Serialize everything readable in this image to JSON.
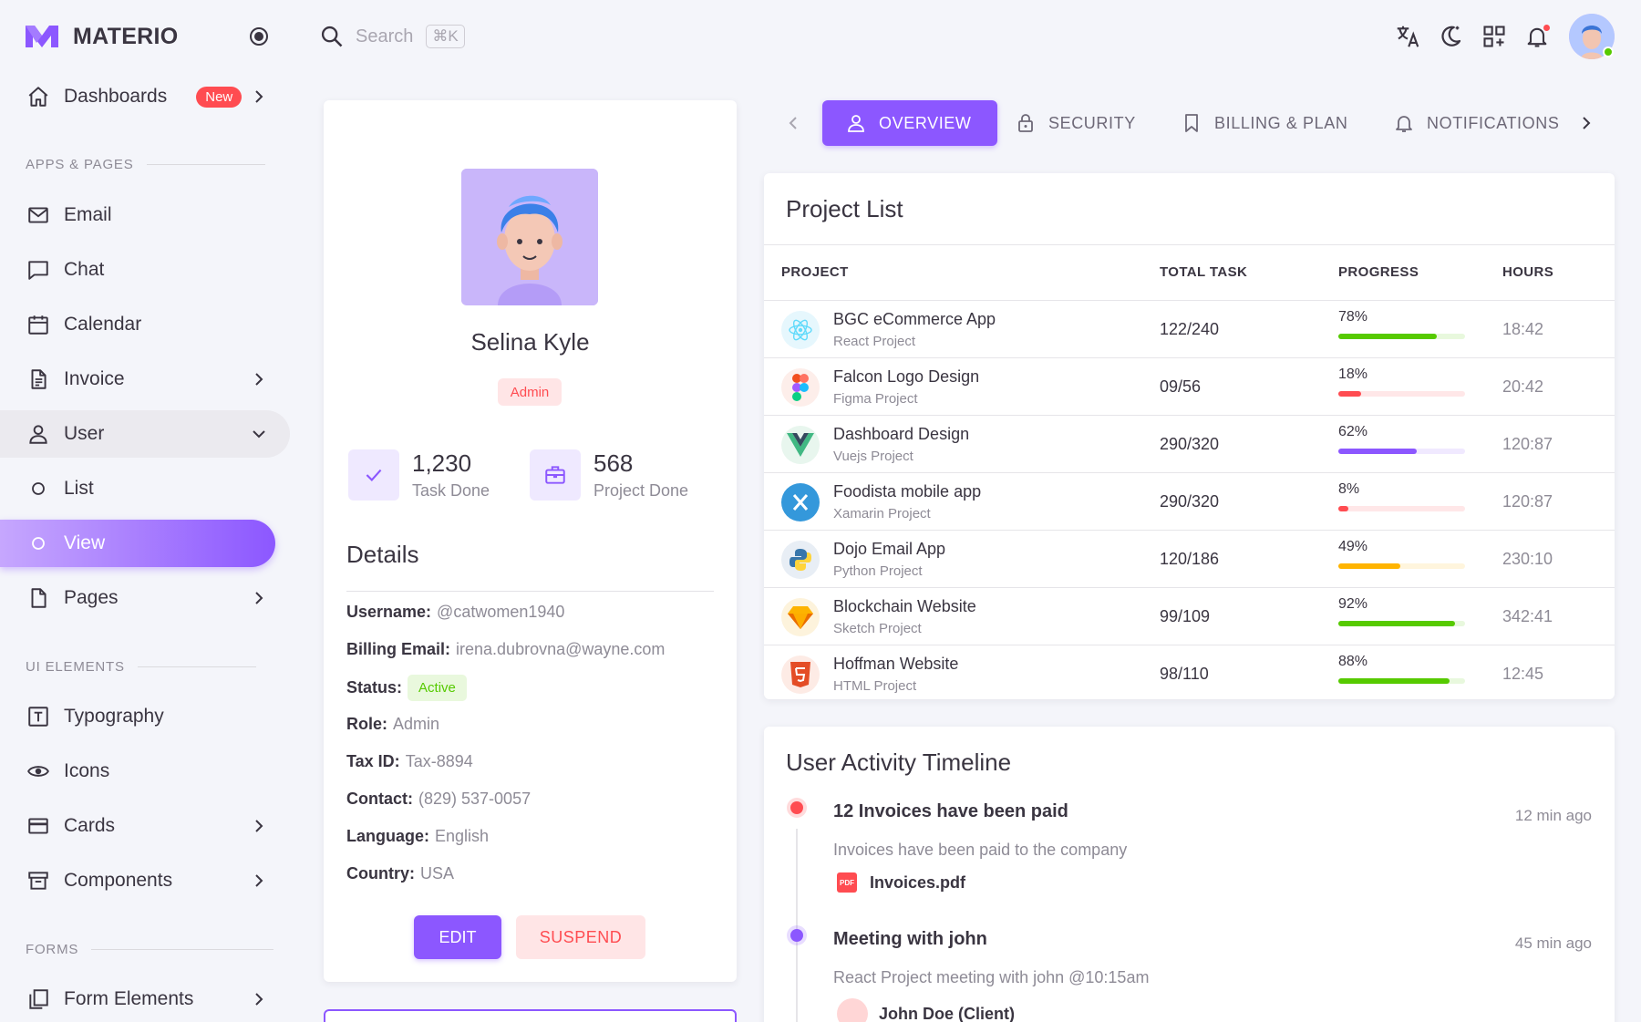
{
  "brand": {
    "name": "MATERIO"
  },
  "search": {
    "placeholder": "Search",
    "shortcut": "⌘K"
  },
  "sidebar": {
    "dashboards": {
      "label": "Dashboards",
      "badge": "New"
    },
    "sections": {
      "apps": "APPS & PAGES",
      "ui": "UI ELEMENTS",
      "forms": "FORMS"
    },
    "items": {
      "email": "Email",
      "chat": "Chat",
      "calendar": "Calendar",
      "invoice": "Invoice",
      "user": "User",
      "list": "List",
      "view": "View",
      "pages": "Pages",
      "typography": "Typography",
      "icons": "Icons",
      "cards": "Cards",
      "components": "Components",
      "form_elements": "Form Elements"
    }
  },
  "profile": {
    "name": "Selina Kyle",
    "role": "Admin",
    "stats": [
      {
        "value": "1,230",
        "label": "Task Done"
      },
      {
        "value": "568",
        "label": "Project Done"
      }
    ],
    "details_title": "Details",
    "details": {
      "username": {
        "label": "Username:",
        "value": "@catwomen1940"
      },
      "billing_email": {
        "label": "Billing Email:",
        "value": "irena.dubrovna@wayne.com"
      },
      "status": {
        "label": "Status:",
        "value": "Active"
      },
      "role": {
        "label": "Role:",
        "value": "Admin"
      },
      "tax_id": {
        "label": "Tax ID:",
        "value": "Tax-8894"
      },
      "contact": {
        "label": "Contact:",
        "value": "(829) 537-0057"
      },
      "language": {
        "label": "Language:",
        "value": "English"
      },
      "country": {
        "label": "Country:",
        "value": "USA"
      }
    },
    "edit_label": "EDIT",
    "suspend_label": "SUSPEND"
  },
  "tabs": {
    "overview": "OVERVIEW",
    "security": "SECURITY",
    "billing": "BILLING & PLAN",
    "notifications": "NOTIFICATIONS"
  },
  "project_list": {
    "title": "Project List",
    "columns": {
      "project": "PROJECT",
      "total_task": "TOTAL TASK",
      "progress": "PROGRESS",
      "hours": "HOURS"
    },
    "rows": [
      {
        "name": "BGC eCommerce App",
        "type": "React Project",
        "tasks": "122/240",
        "progress": "78%",
        "progress_value": 78,
        "color": "#56ca00",
        "hours": "18:42",
        "icon": "react-icon",
        "icon_bg": "#e6f7fd"
      },
      {
        "name": "Falcon Logo Design",
        "type": "Figma Project",
        "tasks": "09/56",
        "progress": "18%",
        "progress_value": 18,
        "color": "#ff4c51",
        "hours": "20:42",
        "icon": "figma-icon",
        "icon_bg": "#fdeeea"
      },
      {
        "name": "Dashboard Design",
        "type": "Vuejs Project",
        "tasks": "290/320",
        "progress": "62%",
        "progress_value": 62,
        "color": "#8c57ff",
        "hours": "120:87",
        "icon": "vue-icon",
        "icon_bg": "#e8f6ee"
      },
      {
        "name": "Foodista mobile app",
        "type": "Xamarin Project",
        "tasks": "290/320",
        "progress": "8%",
        "progress_value": 8,
        "color": "#ff4c51",
        "hours": "120:87",
        "icon": "xamarin-icon",
        "icon_bg": "#3498db"
      },
      {
        "name": "Dojo Email App",
        "type": "Python Project",
        "tasks": "120/186",
        "progress": "49%",
        "progress_value": 49,
        "color": "#ffb400",
        "hours": "230:10",
        "icon": "python-icon",
        "icon_bg": "#e8eef5"
      },
      {
        "name": "Blockchain Website",
        "type": "Sketch Project",
        "tasks": "99/109",
        "progress": "92%",
        "progress_value": 92,
        "color": "#56ca00",
        "hours": "342:41",
        "icon": "sketch-icon",
        "icon_bg": "#fdf3dc"
      },
      {
        "name": "Hoffman Website",
        "type": "HTML Project",
        "tasks": "98/110",
        "progress": "88%",
        "progress_value": 88,
        "color": "#56ca00",
        "hours": "12:45",
        "icon": "html5-icon",
        "icon_bg": "#fdebe5"
      }
    ]
  },
  "timeline": {
    "title": "User Activity Timeline",
    "events": [
      {
        "title": "12 Invoices have been paid",
        "time": "12 min ago",
        "desc": "Invoices have been paid to the company",
        "attachment": "Invoices.pdf",
        "color": "#ff4c51"
      },
      {
        "title": "Meeting with john",
        "time": "45 min ago",
        "desc": "React Project meeting with john @10:15am",
        "attachment": "John Doe (Client)",
        "color": "#8c57ff"
      }
    ]
  }
}
